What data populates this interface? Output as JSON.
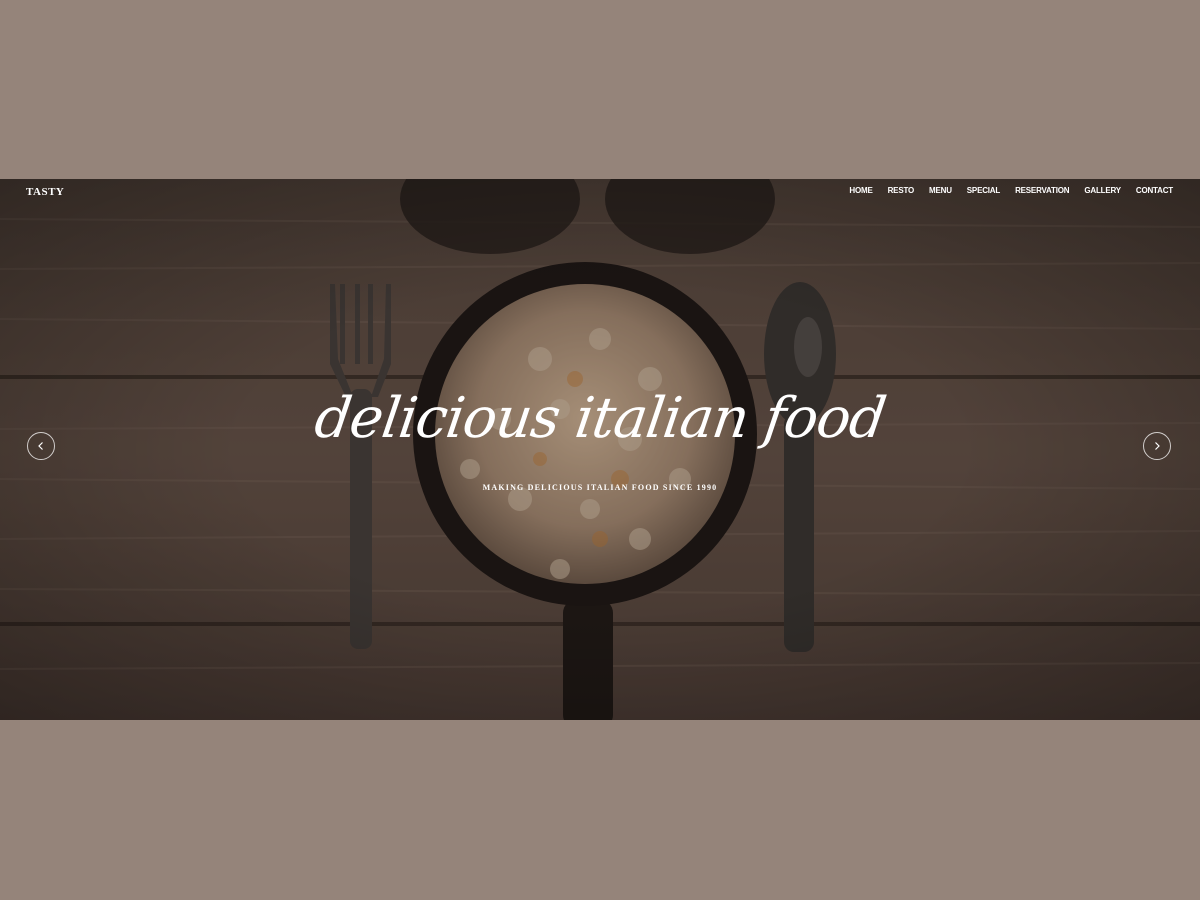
{
  "brand": {
    "name": "TASTY"
  },
  "nav": {
    "items": [
      {
        "label": "HOME"
      },
      {
        "label": "RESTO"
      },
      {
        "label": "MENU"
      },
      {
        "label": "SPECIAL"
      },
      {
        "label": "RESERVATION"
      },
      {
        "label": "GALLERY"
      },
      {
        "label": "CONTACT"
      }
    ]
  },
  "hero": {
    "headline": "delicious italian food",
    "subline": "MAKING DELICIOUS ITALIAN FOOD SINCE 1990",
    "prev_icon": "chevron-left-icon",
    "next_icon": "chevron-right-icon"
  },
  "colors": {
    "page_background": "#95847a",
    "wood_dark": "#3e302a",
    "wood_mid": "#6b584d",
    "text": "#ffffff"
  }
}
